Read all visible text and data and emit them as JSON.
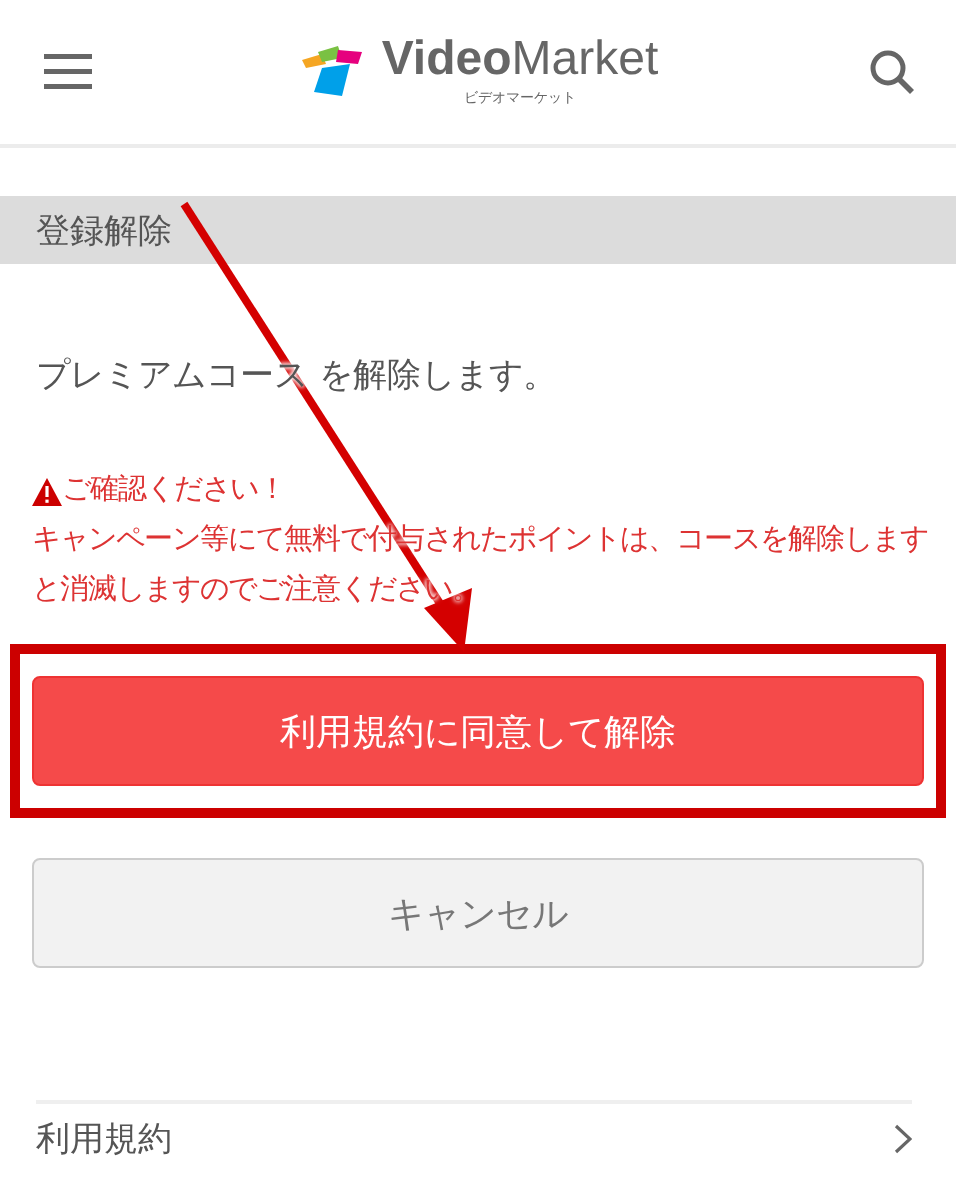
{
  "header": {
    "logo": "**Video**Market",
    "logo_subtitle": "ビデオマーケット"
  },
  "section_title": "登録解除",
  "message": "プレミアムコース を解除します。",
  "warning": {
    "title": "ご確認ください！",
    "body": "キャンペーン等にて無料で付与されたポイントは、コースを解除しますと消滅しますのでご注意ください。"
  },
  "buttons": [
    {
      "kind": "primary",
      "label": "利用規約に同意して解除",
      "highlighted": true
    },
    {
      "kind": "secondary",
      "label": "キャンセル",
      "highlighted": false
    }
  ],
  "links": [
    {
      "label": "利用規約"
    }
  ]
}
